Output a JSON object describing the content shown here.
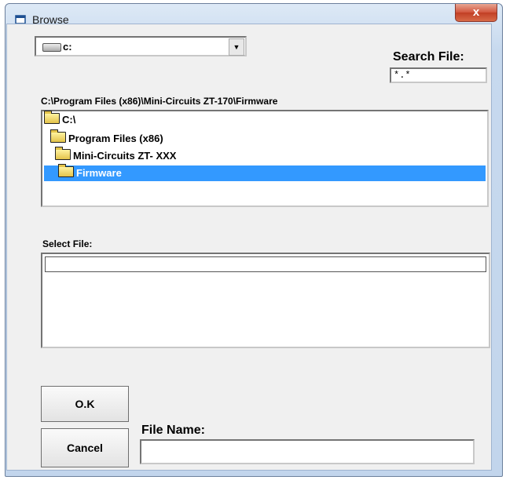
{
  "window": {
    "title": "Browse",
    "close_glyph": "x"
  },
  "drive": {
    "value": "c:",
    "icon": "drive-icon",
    "dropdown_glyph": "▼"
  },
  "search": {
    "label": "Search File:",
    "value": "*.*"
  },
  "path": "C:\\Program Files (x86)\\Mini-Circuits ZT-170\\Firmware",
  "directories": [
    {
      "label": "C:\\",
      "selected": false
    },
    {
      "label": "Program Files (x86)",
      "selected": false
    },
    {
      "label": "Mini-Circuits ZT- XXX",
      "selected": false
    },
    {
      "label": "Firmware",
      "selected": true
    }
  ],
  "select_file": {
    "label": "Select File:",
    "value": ""
  },
  "buttons": {
    "ok": "O.K",
    "cancel": "Cancel"
  },
  "file_name": {
    "label": "File Name:",
    "value": ""
  },
  "colors": {
    "selection": "#3399ff",
    "title_bar": "#c7d9ee",
    "close_button": "#c13f25"
  }
}
